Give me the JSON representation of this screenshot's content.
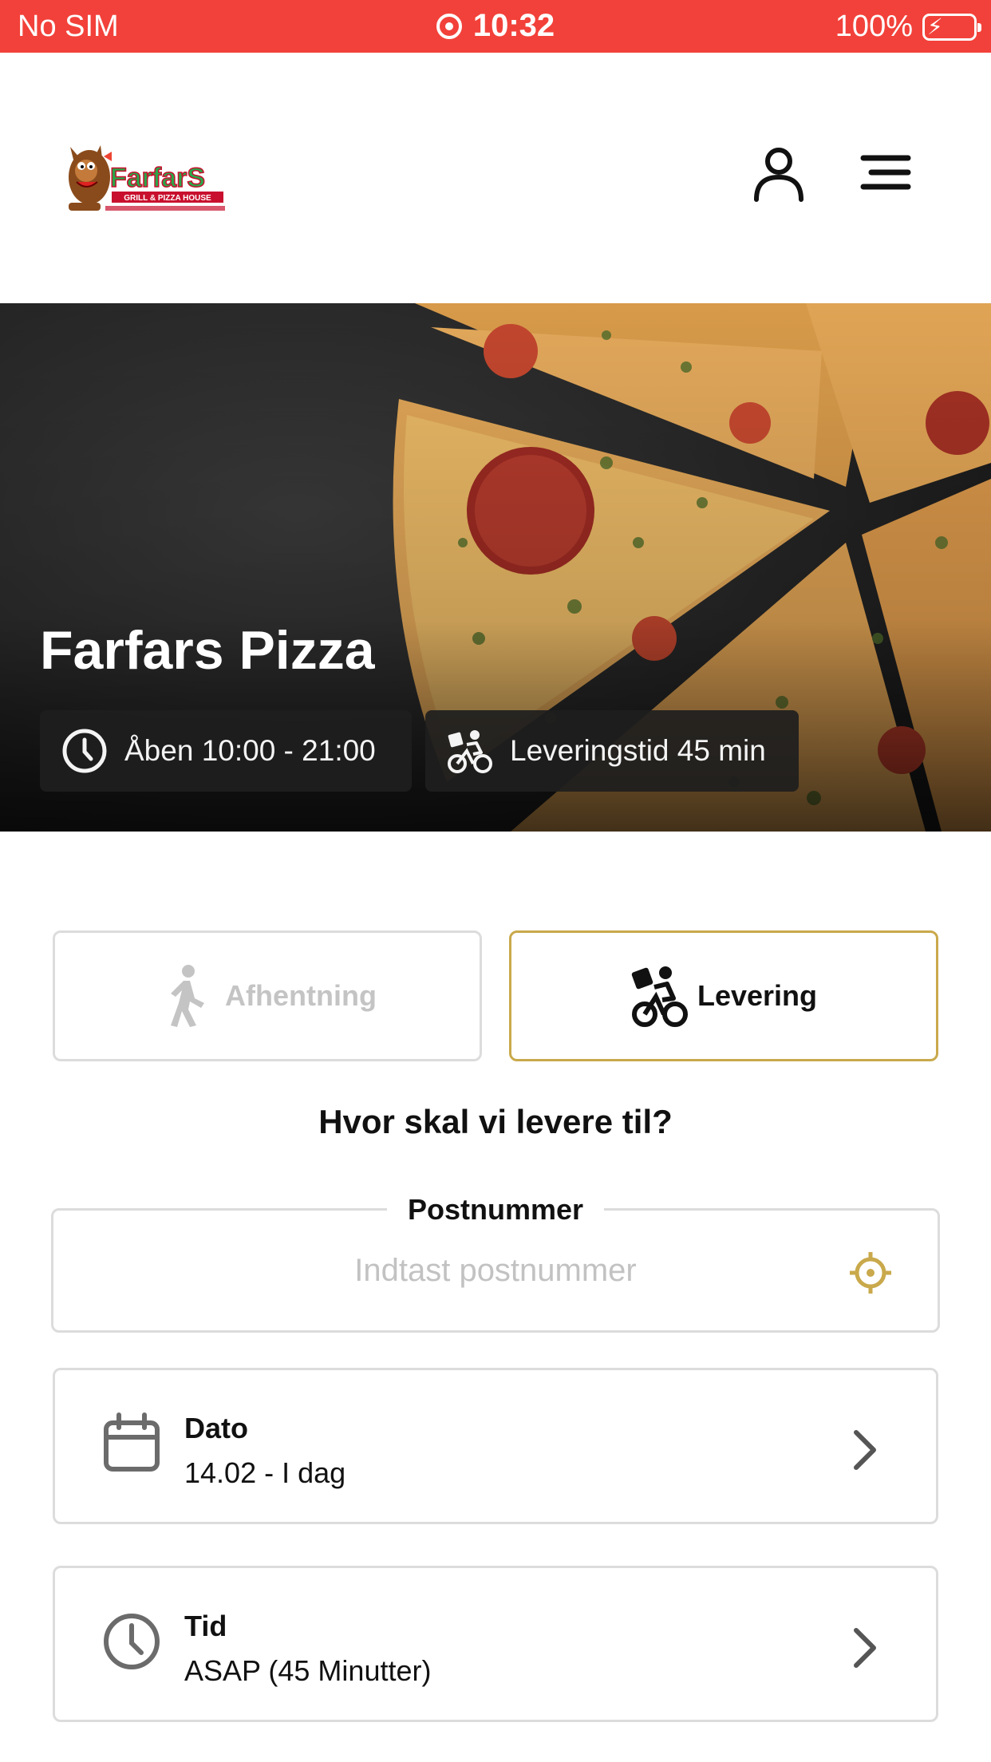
{
  "status_bar": {
    "carrier": "No SIM",
    "time": "10:32",
    "battery": "100%"
  },
  "header": {
    "logo_text": "FarfarS",
    "logo_subtext": "GRILL & PIZZA HOUSE"
  },
  "hero": {
    "title": "Farfars Pizza",
    "hours": "Åben 10:00 - 21:00",
    "delivery_time": "Leveringstid 45 min"
  },
  "order_type": {
    "pickup_label": "Afhentning",
    "delivery_label": "Levering",
    "selected": "Levering"
  },
  "question": "Hvor skal vi levere til?",
  "postal": {
    "label": "Postnummer",
    "placeholder": "Indtast postnummer",
    "value": ""
  },
  "date_row": {
    "title": "Dato",
    "value": "14.02 - I dag"
  },
  "time_row": {
    "title": "Tid",
    "value": "ASAP (45 Minutter)"
  },
  "colors": {
    "status_bar": "#f2413a",
    "accent_gold": "#c9a94b",
    "border": "#dcdcdc"
  },
  "icons": [
    "location-icon",
    "battery-icon",
    "user-icon",
    "menu-icon",
    "clock-icon",
    "bike-delivery-icon",
    "walking-icon",
    "crosshair-icon",
    "calendar-icon",
    "chevron-right-icon"
  ]
}
